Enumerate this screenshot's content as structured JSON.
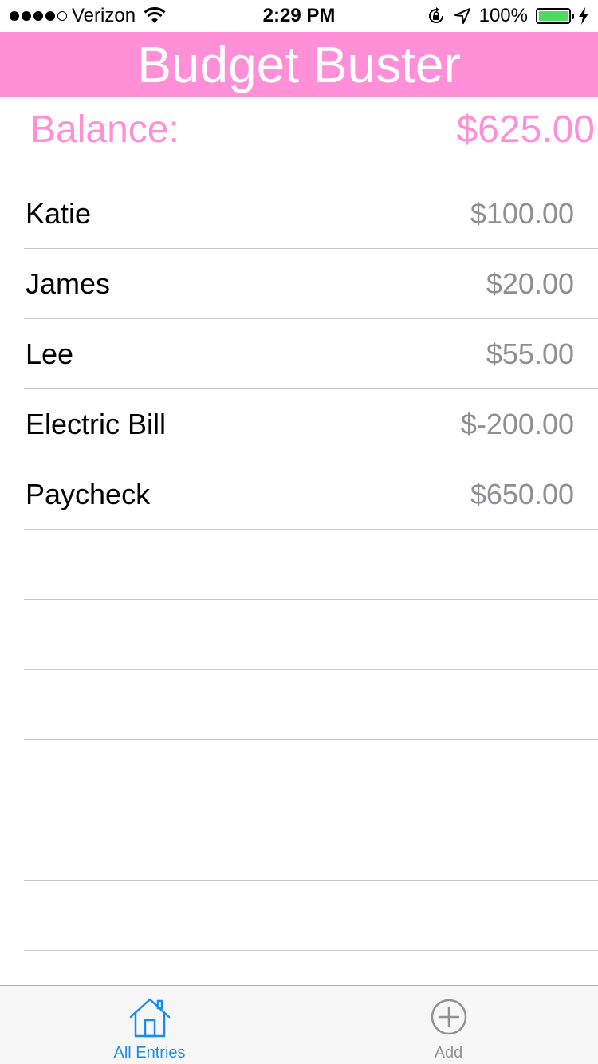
{
  "status_bar": {
    "carrier": "Verizon",
    "time": "2:29 PM",
    "battery_percent": "100%",
    "signal_bars_filled": 4,
    "signal_bars_total": 5
  },
  "header": {
    "title": "Budget Buster"
  },
  "balance": {
    "label": "Balance:",
    "amount": "$625.00"
  },
  "entries": [
    {
      "name": "Katie",
      "amount": "$100.00"
    },
    {
      "name": "James",
      "amount": "$20.00"
    },
    {
      "name": "Lee",
      "amount": "$55.00"
    },
    {
      "name": "Electric Bill",
      "amount": "$-200.00"
    },
    {
      "name": "Paycheck",
      "amount": "$650.00"
    },
    {
      "name": "",
      "amount": ""
    },
    {
      "name": "",
      "amount": ""
    },
    {
      "name": "",
      "amount": ""
    },
    {
      "name": "",
      "amount": ""
    },
    {
      "name": "",
      "amount": ""
    },
    {
      "name": "",
      "amount": ""
    }
  ],
  "tab_bar": {
    "tabs": [
      {
        "label": "All Entries",
        "icon": "house-icon",
        "active": true
      },
      {
        "label": "Add",
        "icon": "add-circle-icon",
        "active": false
      }
    ]
  },
  "colors": {
    "accent_pink": "#ff8fd7",
    "tab_active": "#1a8cf0",
    "tab_inactive": "#929292",
    "amount_gray": "#8e8e93",
    "battery_green": "#4cd964"
  }
}
